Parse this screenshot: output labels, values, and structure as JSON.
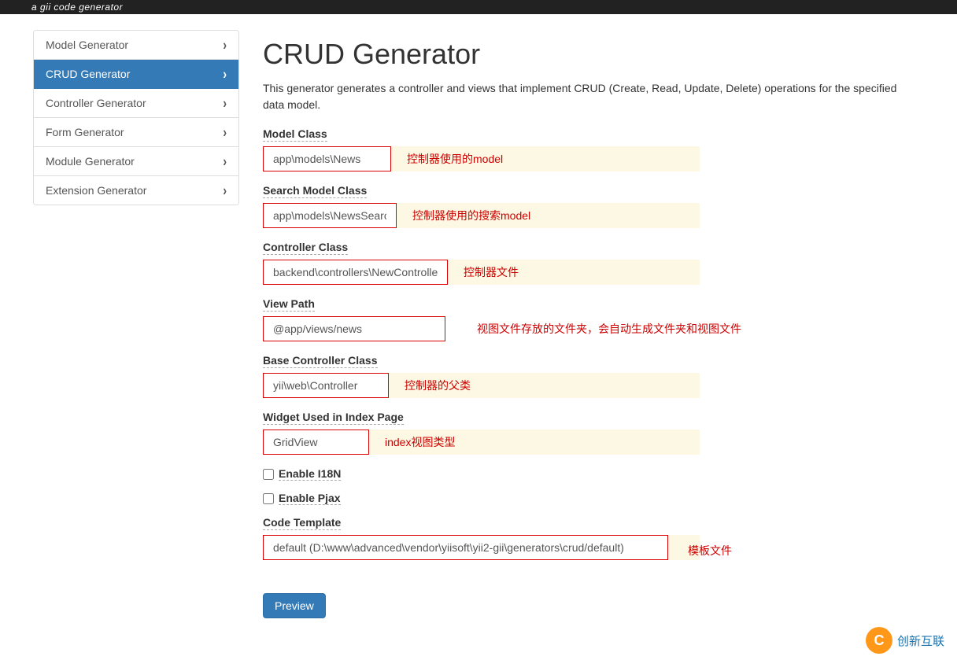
{
  "app": {
    "logo_text": "a gii code generator"
  },
  "sidebar": {
    "items": [
      {
        "label": "Model Generator",
        "active": false
      },
      {
        "label": "CRUD Generator",
        "active": true
      },
      {
        "label": "Controller Generator",
        "active": false
      },
      {
        "label": "Form Generator",
        "active": false
      },
      {
        "label": "Module Generator",
        "active": false
      },
      {
        "label": "Extension Generator",
        "active": false
      }
    ]
  },
  "main": {
    "title": "CRUD Generator",
    "description": "This generator generates a controller and views that implement CRUD (Create, Read, Update, Delete) operations for the specified data model.",
    "fields": {
      "model_class": {
        "label": "Model Class",
        "value": "app\\models\\News",
        "annotation": "控制器使用的model"
      },
      "search_model_class": {
        "label": "Search Model Class",
        "value": "app\\models\\NewsSearch",
        "annotation": "控制器使用的搜索model"
      },
      "controller_class": {
        "label": "Controller Class",
        "value": "backend\\controllers\\NewController",
        "annotation": "控制器文件"
      },
      "view_path": {
        "label": "View Path",
        "value": "@app/views/news",
        "annotation": "视图文件存放的文件夹，会自动生成文件夹和视图文件"
      },
      "base_controller_class": {
        "label": "Base Controller Class",
        "value": "yii\\web\\Controller",
        "annotation": "控制器的父类"
      },
      "widget_index": {
        "label": "Widget Used in Index Page",
        "value": "GridView",
        "annotation": "index视图类型"
      },
      "enable_i18n": {
        "label": "Enable I18N",
        "checked": false
      },
      "enable_pjax": {
        "label": "Enable Pjax",
        "checked": false
      },
      "code_template": {
        "label": "Code Template",
        "value": "default (D:\\www\\advanced\\vendor\\yiisoft\\yii2-gii\\generators\\crud/default)",
        "annotation": "模板文件"
      }
    },
    "preview_button": "Preview"
  },
  "watermark": {
    "icon": "C",
    "text": "创新互联"
  }
}
